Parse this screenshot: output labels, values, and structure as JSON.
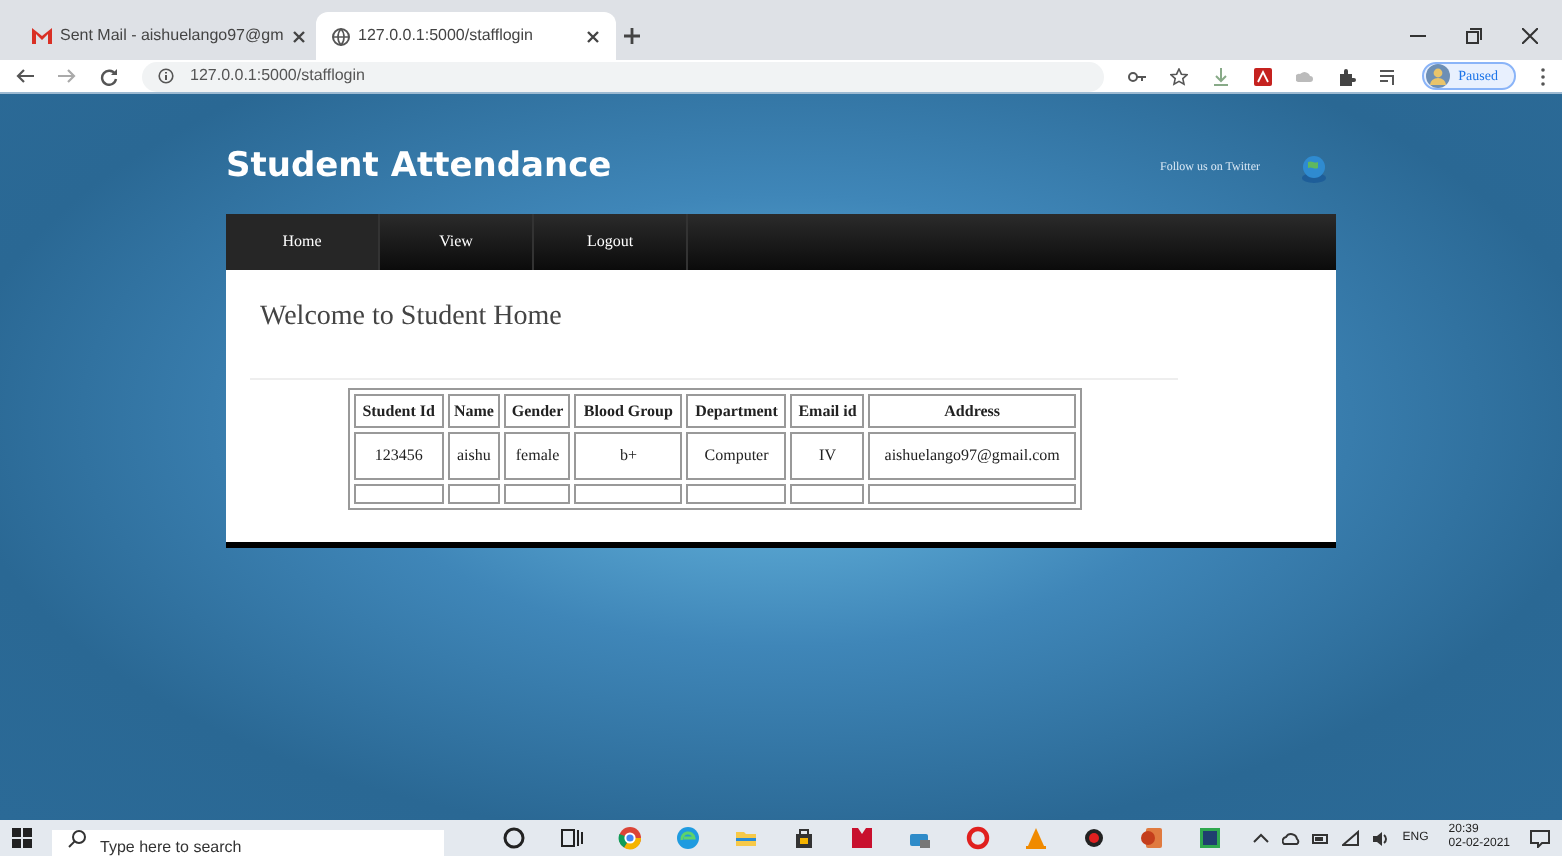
{
  "browser_tabs": [
    {
      "title": "Sent Mail - aishuelango97@gm",
      "selected": false
    },
    {
      "title": "127.0.0.1:5000/stafflogin",
      "selected": true
    }
  ],
  "address_bar": {
    "url": "127.0.0.1:5000/stafflogin"
  },
  "profile_button": "Paused",
  "site": {
    "title": "Student Attendance",
    "follow_link": "Follow us on Twitter"
  },
  "nav": [
    {
      "label": "Home",
      "selected": true
    },
    {
      "label": "View",
      "selected": false
    },
    {
      "label": "Logout",
      "selected": false
    }
  ],
  "heading": "Welcome to Student Home",
  "table": {
    "columns": [
      "Student Id",
      "Name",
      "Gender",
      "Blood Group",
      "Department",
      "Email id",
      "Address"
    ],
    "rows": [
      [
        "123456",
        "aishu",
        "female",
        "b+",
        "Computer",
        "IV",
        "aishuelango97@gmail.com"
      ],
      [
        "",
        "",
        "",
        "",
        "",
        "",
        ""
      ]
    ]
  },
  "taskbar": {
    "search": {
      "placeholder": "Type here to search"
    },
    "language": "ENG",
    "time": "20:39",
    "date": "02-02-2021"
  }
}
